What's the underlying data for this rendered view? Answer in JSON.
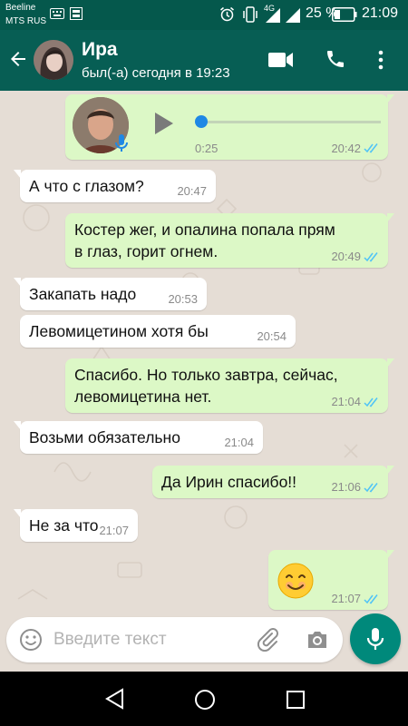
{
  "status_bar": {
    "carrier_1": "Beeline",
    "carrier_2": "MTS RUS",
    "network": "4G",
    "battery": "25 %",
    "time": "21:09"
  },
  "header": {
    "contact_name": "Ира",
    "contact_status": "был(-а) сегодня в 19:23"
  },
  "voice_message": {
    "duration": "0:25",
    "time": "20:42",
    "progress": 0
  },
  "messages": [
    {
      "dir": "in",
      "text": "А что с глазом?",
      "time": "20:47"
    },
    {
      "dir": "out",
      "line1": "Костер жег, и опалина попала прям",
      "line2": "в глаз, горит огнем.",
      "time": "20:49"
    },
    {
      "dir": "in",
      "text": "Закапать надо",
      "time": "20:53"
    },
    {
      "dir": "in",
      "text": "Левомицетином хотя бы",
      "time": "20:54"
    },
    {
      "dir": "out",
      "line1": "Спасибо. Но только завтра, сейчас,",
      "line2": "левомицетина нет.",
      "time": "21:04"
    },
    {
      "dir": "in",
      "text": "Возьми обязательно",
      "time": "21:04"
    },
    {
      "dir": "out",
      "text": "Да Ирин спасибо!!",
      "time": "21:06"
    },
    {
      "dir": "in",
      "text": "Не за что",
      "time": "21:07"
    },
    {
      "dir": "out",
      "emoji": "smiling-face",
      "time": "21:07"
    }
  ],
  "input": {
    "placeholder": "Введите текст"
  },
  "colors": {
    "header": "#075e54",
    "status_bar": "#05584c",
    "outgoing_bubble": "#dcf8c6",
    "incoming_bubble": "#ffffff",
    "read_ticks": "#4fc3f7",
    "fab": "#00897b"
  }
}
